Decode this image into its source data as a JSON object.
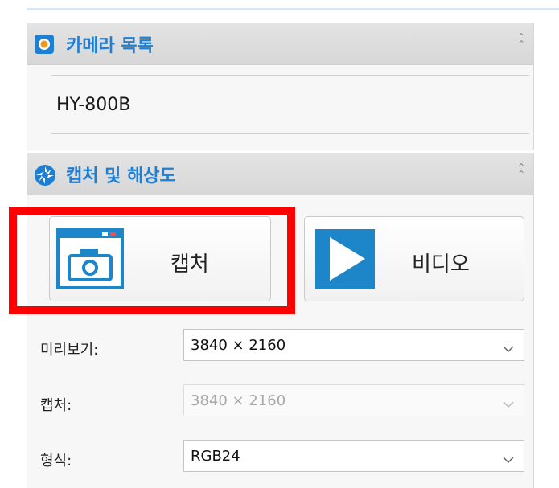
{
  "camera_panel": {
    "title": "카메라 목록",
    "items": [
      {
        "label": "HY-800B"
      }
    ]
  },
  "capture_panel": {
    "title": "캡처 및 해상도",
    "capture_button": {
      "label": "캡처"
    },
    "video_button": {
      "label": "비디오"
    },
    "preview": {
      "label": "미리보기:",
      "value": "3840 × 2160"
    },
    "capture": {
      "label": "캡처:",
      "value": "3840 × 2160",
      "disabled": true
    },
    "format": {
      "label": "형식:",
      "value": "RGB24"
    }
  },
  "colors": {
    "accent": "#1f7fd4",
    "highlight": "#ff0000",
    "play_blue": "#1d86c8"
  }
}
